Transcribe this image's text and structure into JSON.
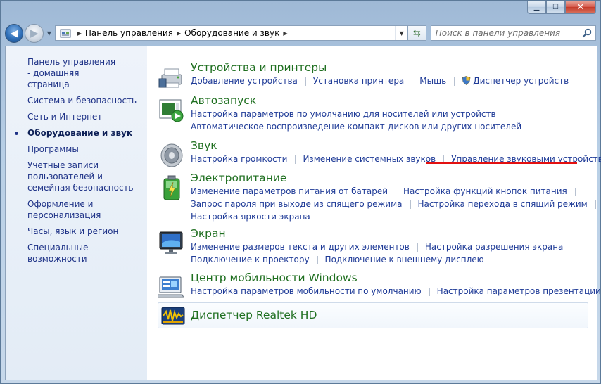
{
  "window": {
    "minimize_glyph": "▁",
    "maximize_glyph": "☐",
    "close_glyph": "✕"
  },
  "navbar": {
    "back_glyph": "◀",
    "forward_glyph": "▶",
    "breadcrumb": [
      "Панель управления",
      "Оборудование и звук"
    ],
    "search_placeholder": "Поиск в панели управления",
    "refresh_glyph": "⇆"
  },
  "sidebar": {
    "items": [
      {
        "label": "Панель управления - домашняя страница",
        "active": false
      },
      {
        "label": "Система и безопасность",
        "active": false
      },
      {
        "label": "Сеть и Интернет",
        "active": false
      },
      {
        "label": "Оборудование и звук",
        "active": true
      },
      {
        "label": "Программы",
        "active": false
      },
      {
        "label": "Учетные записи пользователей и семейная безопасность",
        "active": false
      },
      {
        "label": "Оформление и персонализация",
        "active": false
      },
      {
        "label": "Часы, язык и регион",
        "active": false
      },
      {
        "label": "Специальные возможности",
        "active": false
      }
    ]
  },
  "categories": [
    {
      "title": "Устройства и принтеры",
      "icon": "printer-device-icon",
      "lines": [
        [
          "Добавление устройства",
          "Установка принтера",
          "Мышь",
          "Диспетчер устройств"
        ]
      ]
    },
    {
      "title": "Автозапуск",
      "icon": "autoplay-icon",
      "lines": [
        [
          "Настройка параметров по умолчанию для носителей или устройств"
        ],
        [
          "Автоматическое воспроизведение компакт-дисков или других носителей"
        ]
      ]
    },
    {
      "title": "Звук",
      "icon": "speaker-icon",
      "lines": [
        [
          "Настройка громкости",
          "Изменение системных звуков",
          "Управление звуковыми устройствами"
        ]
      ]
    },
    {
      "title": "Электропитание",
      "icon": "battery-icon",
      "lines": [
        [
          "Изменение параметров питания от батарей",
          "Настройка функций кнопок питания"
        ],
        [
          "Запрос пароля при выходе из спящего режима",
          "Настройка перехода в спящий режим"
        ],
        [
          "Настройка яркости экрана"
        ]
      ]
    },
    {
      "title": "Экран",
      "icon": "monitor-icon",
      "lines": [
        [
          "Изменение размеров текста и других элементов",
          "Настройка разрешения экрана"
        ],
        [
          "Подключение к проектору",
          "Подключение к внешнему дисплею"
        ]
      ]
    },
    {
      "title": "Центр мобильности Windows",
      "icon": "mobility-center-icon",
      "lines": [
        [
          "Настройка параметров мобильности по умолчанию",
          "Настройка параметров презентации"
        ]
      ]
    }
  ],
  "realtek": {
    "title": "Диспетчер Realtek HD",
    "icon": "realtek-audio-icon"
  },
  "colors": {
    "link": "#1f3b97",
    "category_title": "#1f6f20",
    "sidebar_link": "#1e3287",
    "highlight_underline": "#e31010"
  }
}
